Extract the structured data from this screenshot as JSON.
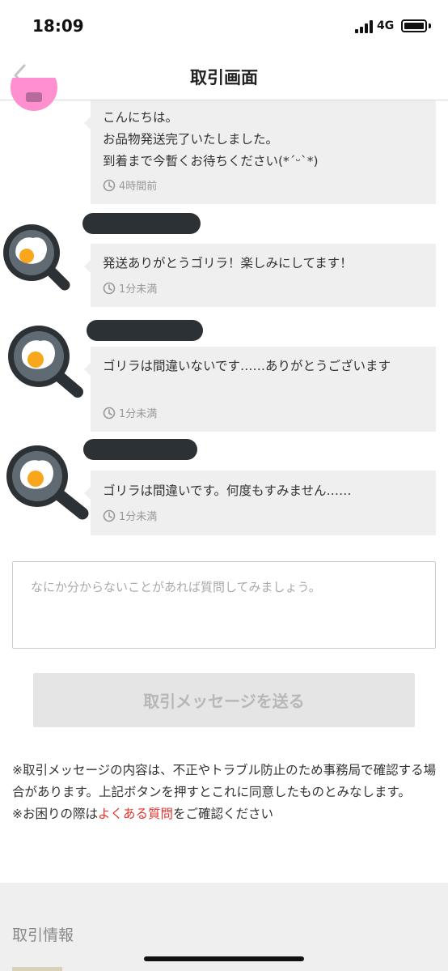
{
  "status_bar": {
    "time": "18:09",
    "network": "4G"
  },
  "header": {
    "title": "取引画面"
  },
  "messages": [
    {
      "text": "こんにちは。\nお品物発送完了いたしました。\n到着まで今暫くお待ちください(*´ᵕ`*)",
      "time": "4時間前"
    },
    {
      "text": "発送ありがとうゴリラ！楽しみにしてます！",
      "time": "1分未満"
    },
    {
      "text": "ゴリラは間違いないです……ありがとうございます",
      "time": "1分未満"
    },
    {
      "text": "ゴリラは間違いです。何度もすみません……",
      "time": "1分未満"
    }
  ],
  "composer": {
    "placeholder": "なにか分からないことがあれば質問してみましょう。",
    "value": "",
    "send_label": "取引メッセージを送る"
  },
  "notice": {
    "line1": "※取引メッセージの内容は、不正やトラブル防止のため事務局で確認する場合があります。上記ボタンを押すとこれに同意したものとみなします。",
    "line2_prefix": "※お困りの際は",
    "line2_link": "よくある質問",
    "line2_suffix": "をご確認ください"
  },
  "info": {
    "title": "取引情報"
  },
  "colors": {
    "accent_link": "#e8322d",
    "bubble_bg": "#efefef",
    "name_redaction": "#2c3136",
    "avatar_pan": "#2c3136",
    "seller_avatar": "#ff8fcf"
  }
}
